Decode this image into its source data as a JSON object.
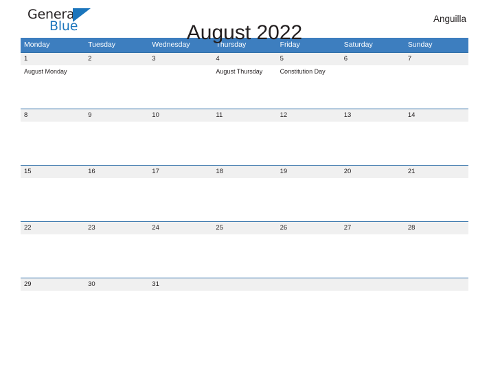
{
  "brand": {
    "name_part1": "General",
    "name_part2": "Blue",
    "flag_icon": "blue-triangle-flag-icon",
    "color_dark": "#231f20",
    "color_blue": "#1b75bc"
  },
  "header": {
    "title": "August 2022",
    "location": "Anguilla"
  },
  "theme": {
    "header_blue": "#3d7ebf",
    "row_border_blue": "#2f6fa8",
    "row_band_gray": "#f0f0f0",
    "text_color": "#231f20",
    "page_background": "#ffffff"
  },
  "calendar": {
    "weekdays": [
      "Monday",
      "Tuesday",
      "Wednesday",
      "Thursday",
      "Friday",
      "Saturday",
      "Sunday"
    ],
    "weeks": [
      [
        {
          "date": "1",
          "events": [
            "August Monday"
          ]
        },
        {
          "date": "2",
          "events": []
        },
        {
          "date": "3",
          "events": []
        },
        {
          "date": "4",
          "events": [
            "August Thursday"
          ]
        },
        {
          "date": "5",
          "events": [
            "Constitution Day"
          ]
        },
        {
          "date": "6",
          "events": []
        },
        {
          "date": "7",
          "events": []
        }
      ],
      [
        {
          "date": "8",
          "events": []
        },
        {
          "date": "9",
          "events": []
        },
        {
          "date": "10",
          "events": []
        },
        {
          "date": "11",
          "events": []
        },
        {
          "date": "12",
          "events": []
        },
        {
          "date": "13",
          "events": []
        },
        {
          "date": "14",
          "events": []
        }
      ],
      [
        {
          "date": "15",
          "events": []
        },
        {
          "date": "16",
          "events": []
        },
        {
          "date": "17",
          "events": []
        },
        {
          "date": "18",
          "events": []
        },
        {
          "date": "19",
          "events": []
        },
        {
          "date": "20",
          "events": []
        },
        {
          "date": "21",
          "events": []
        }
      ],
      [
        {
          "date": "22",
          "events": []
        },
        {
          "date": "23",
          "events": []
        },
        {
          "date": "24",
          "events": []
        },
        {
          "date": "25",
          "events": []
        },
        {
          "date": "26",
          "events": []
        },
        {
          "date": "27",
          "events": []
        },
        {
          "date": "28",
          "events": []
        }
      ],
      [
        {
          "date": "29",
          "events": []
        },
        {
          "date": "30",
          "events": []
        },
        {
          "date": "31",
          "events": []
        },
        {
          "date": "",
          "events": []
        },
        {
          "date": "",
          "events": []
        },
        {
          "date": "",
          "events": []
        },
        {
          "date": "",
          "events": []
        }
      ]
    ]
  }
}
